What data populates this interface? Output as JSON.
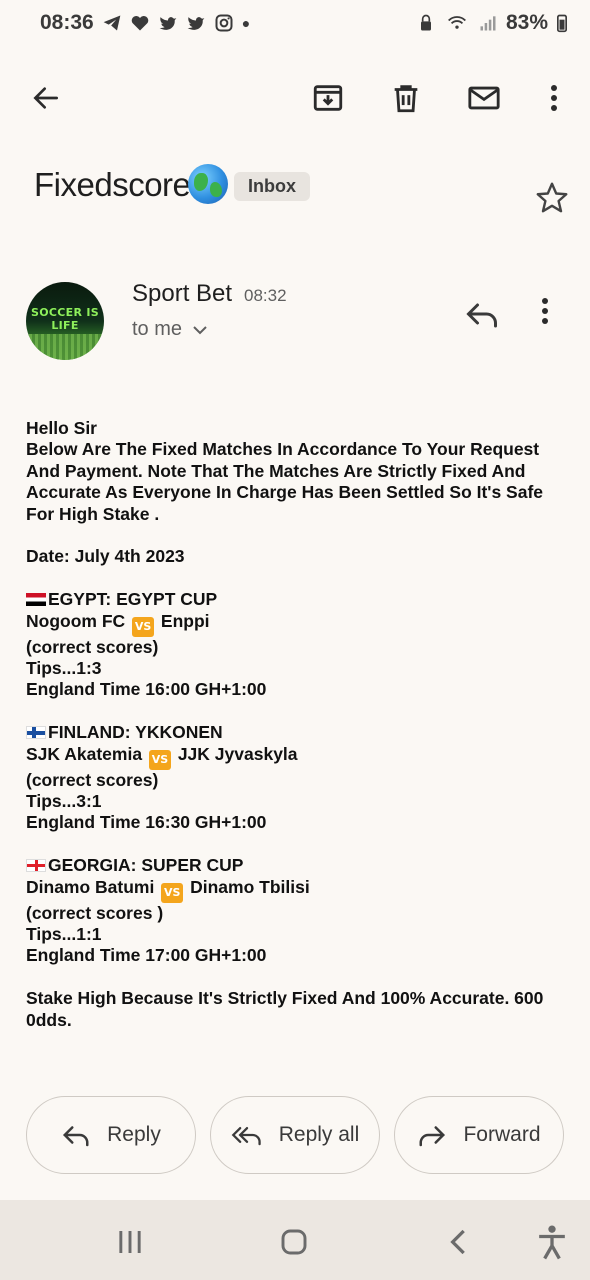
{
  "status_bar": {
    "time": "08:36",
    "battery": "83%"
  },
  "toolbar": {
    "back": "back-arrow-icon",
    "archive": "archive-icon",
    "delete": "trash-icon",
    "mark_unread": "mail-icon",
    "more": "more-vert-icon"
  },
  "email": {
    "subject": "Fixedscore",
    "label": "Inbox",
    "sender": {
      "name": "Sport Bet",
      "time": "08:32",
      "recipient": "to me",
      "avatar_text": "SOCCER IS LIFE"
    },
    "body": {
      "greeting": "Hello Sir",
      "intro": "Below Are The Fixed Matches In Accordance To Your Request And Payment. Note That The Matches Are Strictly Fixed And Accurate As Everyone In Charge Has Been Settled So It's Safe For High Stake .",
      "date": "Date: July 4th 2023",
      "matches": [
        {
          "league": "EGYPT: EGYPT CUP",
          "home": "Nogoom FC",
          "away": "Enppi",
          "type": "(correct scores)",
          "tips": "Tips...1:3",
          "time": "England Time 16:00 GH+1:00"
        },
        {
          "league": "FINLAND: YKKONEN",
          "home": "SJK Akatemia",
          "away": "JJK Jyvaskyla",
          "type": "(correct scores)",
          "tips": "Tips...3:1",
          "time": "England Time 16:30 GH+1:00"
        },
        {
          "league": "GEORGIA: SUPER CUP",
          "home": "Dinamo Batumi",
          "away": "Dinamo Tbilisi",
          "type": "(correct scores )",
          "tips": "Tips...1:1",
          "time": "England Time 17:00 GH+1:00"
        }
      ],
      "closing": "Stake High Because It's Strictly Fixed And 100% Accurate. 600 0dds."
    }
  },
  "actions": {
    "reply": "Reply",
    "reply_all": "Reply all",
    "forward": "Forward"
  },
  "colors": {
    "background": "#fbf8f4",
    "nav_background": "#ece7e1",
    "badge_background": "#e8e4df",
    "vs_badge": "#f4a51c"
  }
}
